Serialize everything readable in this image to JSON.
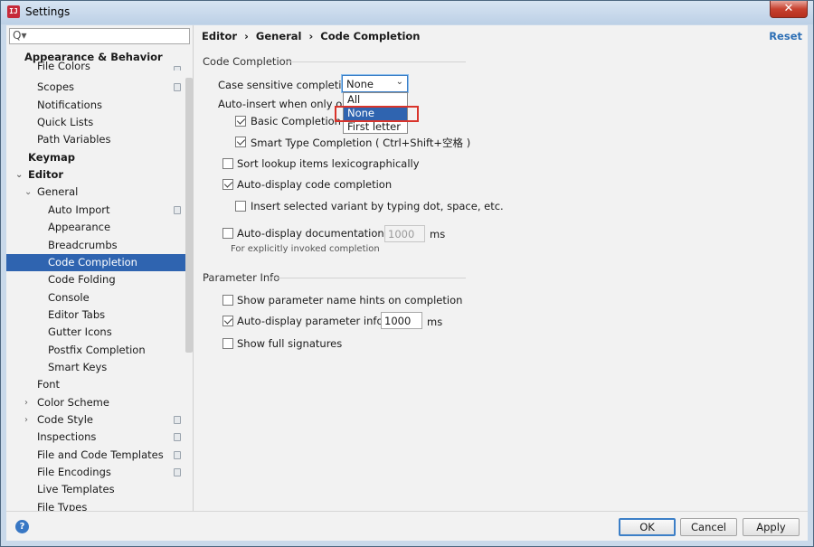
{
  "window": {
    "title": "Settings",
    "app_icon_letter": "IJ",
    "close_glyph": "✕"
  },
  "search": {
    "glyph": "Q▾"
  },
  "sidebar": {
    "items": [
      {
        "label": "File Colors",
        "level": 2,
        "bold": false,
        "arrow": "",
        "proj": true
      },
      {
        "label": "Scopes",
        "level": 2,
        "bold": false,
        "arrow": "",
        "proj": true
      },
      {
        "label": "Notifications",
        "level": 2,
        "bold": false,
        "arrow": "",
        "proj": false
      },
      {
        "label": "Quick Lists",
        "level": 2,
        "bold": false,
        "arrow": "",
        "proj": false
      },
      {
        "label": "Path Variables",
        "level": 2,
        "bold": false,
        "arrow": "",
        "proj": false
      },
      {
        "label": "Keymap",
        "level": 1,
        "bold": true,
        "arrow": "",
        "proj": false
      },
      {
        "label": "Editor",
        "level": 1,
        "bold": true,
        "arrow": "⌄",
        "proj": false
      },
      {
        "label": "General",
        "level": 2,
        "bold": false,
        "arrow": "⌄",
        "proj": false
      },
      {
        "label": "Auto Import",
        "level": 3,
        "bold": false,
        "arrow": "",
        "proj": true
      },
      {
        "label": "Appearance",
        "level": 3,
        "bold": false,
        "arrow": "",
        "proj": false
      },
      {
        "label": "Breadcrumbs",
        "level": 3,
        "bold": false,
        "arrow": "",
        "proj": false
      },
      {
        "label": "Code Completion",
        "level": 3,
        "bold": false,
        "arrow": "",
        "proj": false,
        "selected": true
      },
      {
        "label": "Code Folding",
        "level": 3,
        "bold": false,
        "arrow": "",
        "proj": false
      },
      {
        "label": "Console",
        "level": 3,
        "bold": false,
        "arrow": "",
        "proj": false
      },
      {
        "label": "Editor Tabs",
        "level": 3,
        "bold": false,
        "arrow": "",
        "proj": false
      },
      {
        "label": "Gutter Icons",
        "level": 3,
        "bold": false,
        "arrow": "",
        "proj": false
      },
      {
        "label": "Postfix Completion",
        "level": 3,
        "bold": false,
        "arrow": "",
        "proj": false
      },
      {
        "label": "Smart Keys",
        "level": 3,
        "bold": false,
        "arrow": "",
        "proj": false
      },
      {
        "label": "Font",
        "level": 2,
        "bold": false,
        "arrow": "",
        "proj": false
      },
      {
        "label": "Color Scheme",
        "level": 2,
        "bold": false,
        "arrow": "›",
        "proj": false
      },
      {
        "label": "Code Style",
        "level": 2,
        "bold": false,
        "arrow": "›",
        "proj": true
      },
      {
        "label": "Inspections",
        "level": 2,
        "bold": false,
        "arrow": "",
        "proj": true
      },
      {
        "label": "File and Code Templates",
        "level": 2,
        "bold": false,
        "arrow": "",
        "proj": true
      },
      {
        "label": "File Encodings",
        "level": 2,
        "bold": false,
        "arrow": "",
        "proj": true
      },
      {
        "label": "Live Templates",
        "level": 2,
        "bold": false,
        "arrow": "",
        "proj": false
      },
      {
        "label": "File Types",
        "level": 2,
        "bold": false,
        "arrow": "",
        "proj": false
      }
    ],
    "header": "Appearance & Behavior"
  },
  "breadcrumb": {
    "parts": [
      "Editor",
      "General",
      "Code Completion"
    ],
    "sep": "›"
  },
  "reset_label": "Reset",
  "code_completion": {
    "section_title": "Code Completion",
    "case_sensitive_label": "Case sensitive completion:",
    "case_sensitive_value": "None",
    "chevron": "⌄",
    "dropdown_options": [
      "All",
      "None",
      "First letter"
    ],
    "dropdown_selected": "None",
    "auto_insert_label": "Auto-insert when only one",
    "basic_label": "Basic Completion (C",
    "basic_checked": true,
    "smart_label": "Smart Type Completion ( Ctrl+Shift+空格 )",
    "smart_checked": true,
    "sort_label": "Sort lookup items lexicographically",
    "sort_checked": false,
    "auto_display_label": "Auto-display code completion",
    "auto_display_checked": true,
    "insert_variant_label": "Insert selected variant by typing dot, space, etc.",
    "insert_variant_checked": false,
    "auto_doc_label": "Auto-display documentation in",
    "auto_doc_checked": false,
    "auto_doc_value": "1000",
    "auto_doc_unit": "ms",
    "explicit_hint": "For explicitly invoked completion"
  },
  "parameter_info": {
    "section_title": "Parameter Info",
    "hints_label": "Show parameter name hints on completion",
    "hints_checked": false,
    "auto_param_label": "Auto-display parameter info in",
    "auto_param_checked": true,
    "auto_param_value": "1000",
    "auto_param_unit": "ms",
    "full_sig_label": "Show full signatures",
    "full_sig_checked": false
  },
  "buttons": {
    "help": "?",
    "ok": "OK",
    "cancel": "Cancel",
    "apply": "Apply"
  }
}
